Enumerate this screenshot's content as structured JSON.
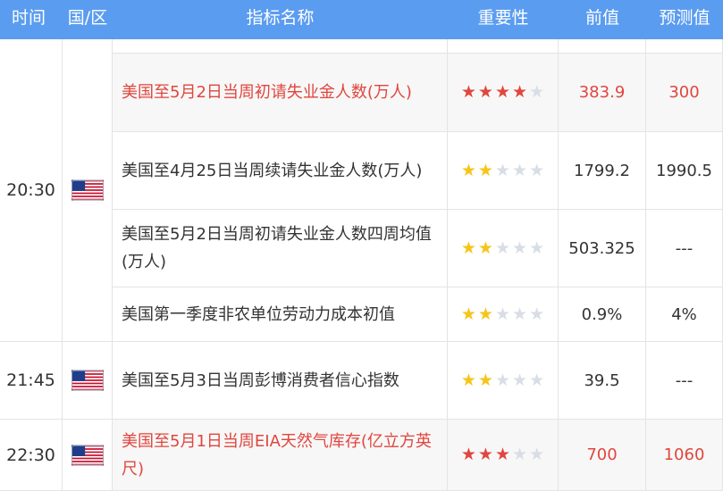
{
  "header": {
    "time": "时间",
    "country": "国/区",
    "indicator": "指标名称",
    "importance": "重要性",
    "previous": "前值",
    "forecast": "预测值"
  },
  "groups": [
    {
      "time": "20:30",
      "flag": "us-flag-icon"
    },
    {
      "time": "21:45",
      "flag": "us-flag-icon"
    },
    {
      "time": "22:30",
      "flag": "us-flag-icon"
    }
  ],
  "rows": [
    {
      "name": "美国至5月2日当周初请失业金人数(万人)",
      "stars": 4,
      "star_color": "red",
      "previous": "383.9",
      "forecast": "300",
      "highlight": true
    },
    {
      "name": "美国至4月25日当周续请失业金人数(万人)",
      "stars": 2,
      "star_color": "yellow",
      "previous": "1799.2",
      "forecast": "1990.5",
      "highlight": false
    },
    {
      "name": "美国至5月2日当周初请失业金人数四周均值(万人)",
      "stars": 2,
      "star_color": "yellow",
      "previous": "503.325",
      "forecast": "---",
      "highlight": false
    },
    {
      "name": "美国第一季度非农单位劳动力成本初值",
      "stars": 2,
      "star_color": "yellow",
      "previous": "0.9%",
      "forecast": "4%",
      "highlight": false
    },
    {
      "name": "美国至5月3日当周彭博消费者信心指数",
      "stars": 2,
      "star_color": "yellow",
      "previous": "39.5",
      "forecast": "---",
      "highlight": false
    },
    {
      "name": "美国至5月1日当周EIA天然气库存(亿立方英尺)",
      "stars": 3,
      "star_color": "red",
      "previous": "700",
      "forecast": "1060",
      "highlight": true
    }
  ],
  "colors": {
    "header_bg": "#5a9cf0",
    "red": "#e0463e",
    "star_yellow": "#f5c518",
    "star_off": "#d8dde6"
  }
}
